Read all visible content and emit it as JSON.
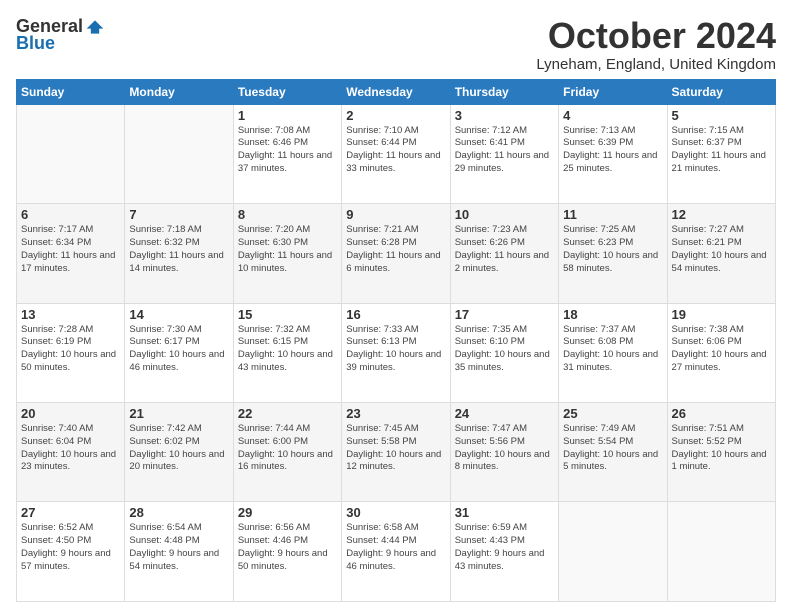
{
  "logo": {
    "general": "General",
    "blue": "Blue"
  },
  "header": {
    "month": "October 2024",
    "location": "Lyneham, England, United Kingdom"
  },
  "days": [
    "Sunday",
    "Monday",
    "Tuesday",
    "Wednesday",
    "Thursday",
    "Friday",
    "Saturday"
  ],
  "weeks": [
    [
      {
        "day": "",
        "info": ""
      },
      {
        "day": "",
        "info": ""
      },
      {
        "day": "1",
        "info": "Sunrise: 7:08 AM\nSunset: 6:46 PM\nDaylight: 11 hours and 37 minutes."
      },
      {
        "day": "2",
        "info": "Sunrise: 7:10 AM\nSunset: 6:44 PM\nDaylight: 11 hours and 33 minutes."
      },
      {
        "day": "3",
        "info": "Sunrise: 7:12 AM\nSunset: 6:41 PM\nDaylight: 11 hours and 29 minutes."
      },
      {
        "day": "4",
        "info": "Sunrise: 7:13 AM\nSunset: 6:39 PM\nDaylight: 11 hours and 25 minutes."
      },
      {
        "day": "5",
        "info": "Sunrise: 7:15 AM\nSunset: 6:37 PM\nDaylight: 11 hours and 21 minutes."
      }
    ],
    [
      {
        "day": "6",
        "info": "Sunrise: 7:17 AM\nSunset: 6:34 PM\nDaylight: 11 hours and 17 minutes."
      },
      {
        "day": "7",
        "info": "Sunrise: 7:18 AM\nSunset: 6:32 PM\nDaylight: 11 hours and 14 minutes."
      },
      {
        "day": "8",
        "info": "Sunrise: 7:20 AM\nSunset: 6:30 PM\nDaylight: 11 hours and 10 minutes."
      },
      {
        "day": "9",
        "info": "Sunrise: 7:21 AM\nSunset: 6:28 PM\nDaylight: 11 hours and 6 minutes."
      },
      {
        "day": "10",
        "info": "Sunrise: 7:23 AM\nSunset: 6:26 PM\nDaylight: 11 hours and 2 minutes."
      },
      {
        "day": "11",
        "info": "Sunrise: 7:25 AM\nSunset: 6:23 PM\nDaylight: 10 hours and 58 minutes."
      },
      {
        "day": "12",
        "info": "Sunrise: 7:27 AM\nSunset: 6:21 PM\nDaylight: 10 hours and 54 minutes."
      }
    ],
    [
      {
        "day": "13",
        "info": "Sunrise: 7:28 AM\nSunset: 6:19 PM\nDaylight: 10 hours and 50 minutes."
      },
      {
        "day": "14",
        "info": "Sunrise: 7:30 AM\nSunset: 6:17 PM\nDaylight: 10 hours and 46 minutes."
      },
      {
        "day": "15",
        "info": "Sunrise: 7:32 AM\nSunset: 6:15 PM\nDaylight: 10 hours and 43 minutes."
      },
      {
        "day": "16",
        "info": "Sunrise: 7:33 AM\nSunset: 6:13 PM\nDaylight: 10 hours and 39 minutes."
      },
      {
        "day": "17",
        "info": "Sunrise: 7:35 AM\nSunset: 6:10 PM\nDaylight: 10 hours and 35 minutes."
      },
      {
        "day": "18",
        "info": "Sunrise: 7:37 AM\nSunset: 6:08 PM\nDaylight: 10 hours and 31 minutes."
      },
      {
        "day": "19",
        "info": "Sunrise: 7:38 AM\nSunset: 6:06 PM\nDaylight: 10 hours and 27 minutes."
      }
    ],
    [
      {
        "day": "20",
        "info": "Sunrise: 7:40 AM\nSunset: 6:04 PM\nDaylight: 10 hours and 23 minutes."
      },
      {
        "day": "21",
        "info": "Sunrise: 7:42 AM\nSunset: 6:02 PM\nDaylight: 10 hours and 20 minutes."
      },
      {
        "day": "22",
        "info": "Sunrise: 7:44 AM\nSunset: 6:00 PM\nDaylight: 10 hours and 16 minutes."
      },
      {
        "day": "23",
        "info": "Sunrise: 7:45 AM\nSunset: 5:58 PM\nDaylight: 10 hours and 12 minutes."
      },
      {
        "day": "24",
        "info": "Sunrise: 7:47 AM\nSunset: 5:56 PM\nDaylight: 10 hours and 8 minutes."
      },
      {
        "day": "25",
        "info": "Sunrise: 7:49 AM\nSunset: 5:54 PM\nDaylight: 10 hours and 5 minutes."
      },
      {
        "day": "26",
        "info": "Sunrise: 7:51 AM\nSunset: 5:52 PM\nDaylight: 10 hours and 1 minute."
      }
    ],
    [
      {
        "day": "27",
        "info": "Sunrise: 6:52 AM\nSunset: 4:50 PM\nDaylight: 9 hours and 57 minutes."
      },
      {
        "day": "28",
        "info": "Sunrise: 6:54 AM\nSunset: 4:48 PM\nDaylight: 9 hours and 54 minutes."
      },
      {
        "day": "29",
        "info": "Sunrise: 6:56 AM\nSunset: 4:46 PM\nDaylight: 9 hours and 50 minutes."
      },
      {
        "day": "30",
        "info": "Sunrise: 6:58 AM\nSunset: 4:44 PM\nDaylight: 9 hours and 46 minutes."
      },
      {
        "day": "31",
        "info": "Sunrise: 6:59 AM\nSunset: 4:43 PM\nDaylight: 9 hours and 43 minutes."
      },
      {
        "day": "",
        "info": ""
      },
      {
        "day": "",
        "info": ""
      }
    ]
  ]
}
